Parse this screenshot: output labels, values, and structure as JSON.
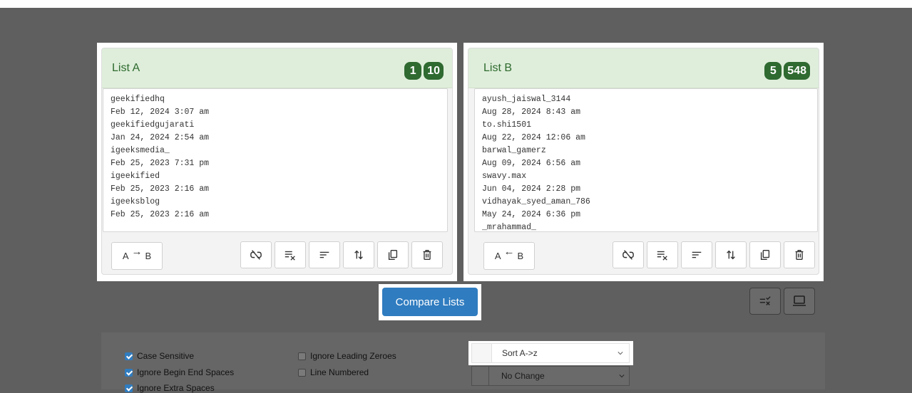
{
  "listA": {
    "title": "List A",
    "badges": [
      "1",
      "10"
    ],
    "content": "geekifiedhq\nFeb 12, 2024 3:07 am\ngeekifiedgujarati\nJan 24, 2024 2:54 am\nigeeksmedia_\nFeb 25, 2023 7:31 pm\nigeekified\nFeb 25, 2023 2:16 am\nigeeksblog\nFeb 25, 2023 2:16 am",
    "move_button": {
      "left": "A",
      "arrow": "→",
      "right": "B"
    }
  },
  "listB": {
    "title": "List B",
    "badges": [
      "5",
      "548"
    ],
    "content": "ayush_jaiswal_3144\nAug 28, 2024 8:43 am\nto.shi1501\nAug 22, 2024 12:06 am\nbarwal_gamerz\nAug 09, 2024 6:56 am\nswavy.max\nJun 04, 2024 2:28 pm\nvidhayak_syed_aman_786\nMay 24, 2024 6:36 pm\n_mrahammad_",
    "move_button": {
      "left": "A",
      "arrow": "←",
      "right": "B"
    }
  },
  "tools": [
    "unlink-icon",
    "clear-format-icon",
    "sort-lines-icon",
    "swap-vertical-icon",
    "copy-icon",
    "trash-icon"
  ],
  "compare_button": "Compare Lists",
  "options": {
    "case_sensitive": {
      "label": "Case Sensitive",
      "checked": true
    },
    "ignore_begin_end_spaces": {
      "label": "Ignore Begin End Spaces",
      "checked": true
    },
    "ignore_extra_spaces": {
      "label": "Ignore Extra Spaces",
      "checked": true
    },
    "ignore_leading_zeroes": {
      "label": "Ignore Leading Zeroes",
      "checked": false
    },
    "line_numbered": {
      "label": "Line Numbered",
      "checked": false
    }
  },
  "sort_select": {
    "value": "Sort A->z"
  },
  "case_select": {
    "value": "No Change"
  },
  "colors": {
    "accent": "#2f7cc0",
    "header_bg": "#dfeedb",
    "badge": "#2f6a31",
    "overlay": "#5f5f5f"
  }
}
